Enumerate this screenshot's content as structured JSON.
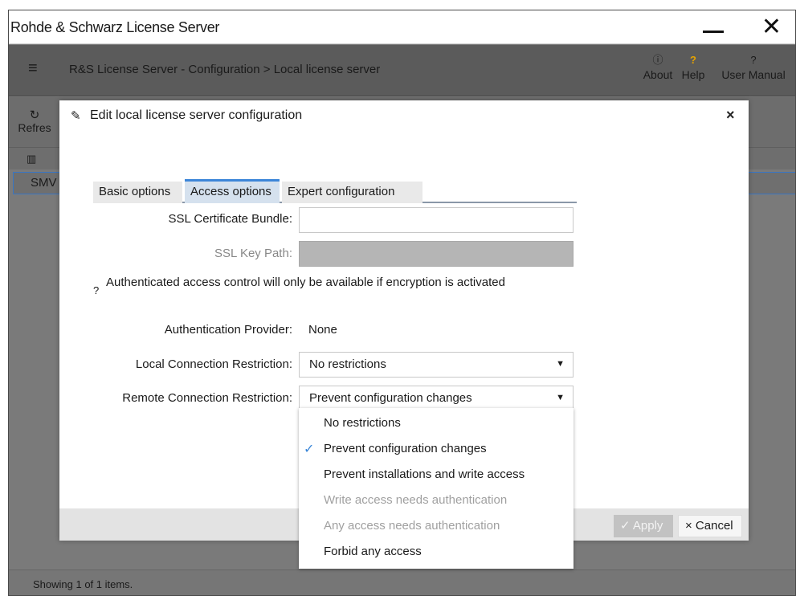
{
  "window": {
    "title": "Rohde & Schwarz License Server",
    "minimize": "—",
    "close": "✕"
  },
  "appbar": {
    "menu_icon": "≡",
    "breadcrumb": "R&S License Server - Configuration > Local license server",
    "about": {
      "icon": "ⓘ",
      "label": "About"
    },
    "help": {
      "icon": "?",
      "label": "Help"
    },
    "manual": {
      "icon": "?",
      "label": "User Manual"
    }
  },
  "toolbar": {
    "refresh_icon": "↻",
    "refresh_label": "Refres"
  },
  "grid": {
    "column_icon": "▥",
    "row1_text": "SMV"
  },
  "footer": {
    "status": "Showing 1 of 1 items."
  },
  "dialog": {
    "title": "Edit local license server configuration",
    "close": "×",
    "tabs": [
      "Basic options",
      "Access options",
      "Expert configuration"
    ],
    "active_tab": "Access options",
    "ssl_bundle_label": "SSL Certificate Bundle:",
    "ssl_bundle_value": "",
    "ssl_key_label": "SSL Key Path:",
    "ssl_key_value": "",
    "info_text": "Authenticated access control will only be available if encryption is activated",
    "auth_provider_label": "Authentication Provider:",
    "auth_provider_value": "None",
    "local_restriction_label": "Local Connection Restriction:",
    "local_restriction_value": "No restrictions",
    "remote_restriction_label": "Remote Connection Restriction:",
    "remote_restriction_value": "Prevent configuration changes",
    "apply_label": "✓ Apply",
    "cancel_label": "× Cancel"
  },
  "dropdown": {
    "options": [
      {
        "label": "No restrictions",
        "disabled": false,
        "selected": false
      },
      {
        "label": "Prevent configuration changes",
        "disabled": false,
        "selected": true
      },
      {
        "label": "Prevent installations and write access",
        "disabled": false,
        "selected": false
      },
      {
        "label": "Write access needs authentication",
        "disabled": true,
        "selected": false
      },
      {
        "label": "Any access needs authentication",
        "disabled": true,
        "selected": false
      },
      {
        "label": "Forbid any access",
        "disabled": false,
        "selected": false
      }
    ],
    "check_icon": "✓"
  },
  "colors": {
    "accent": "#3d86d8",
    "disabled_text": "#a0a0a0",
    "overlay": "#7a7a7a"
  }
}
